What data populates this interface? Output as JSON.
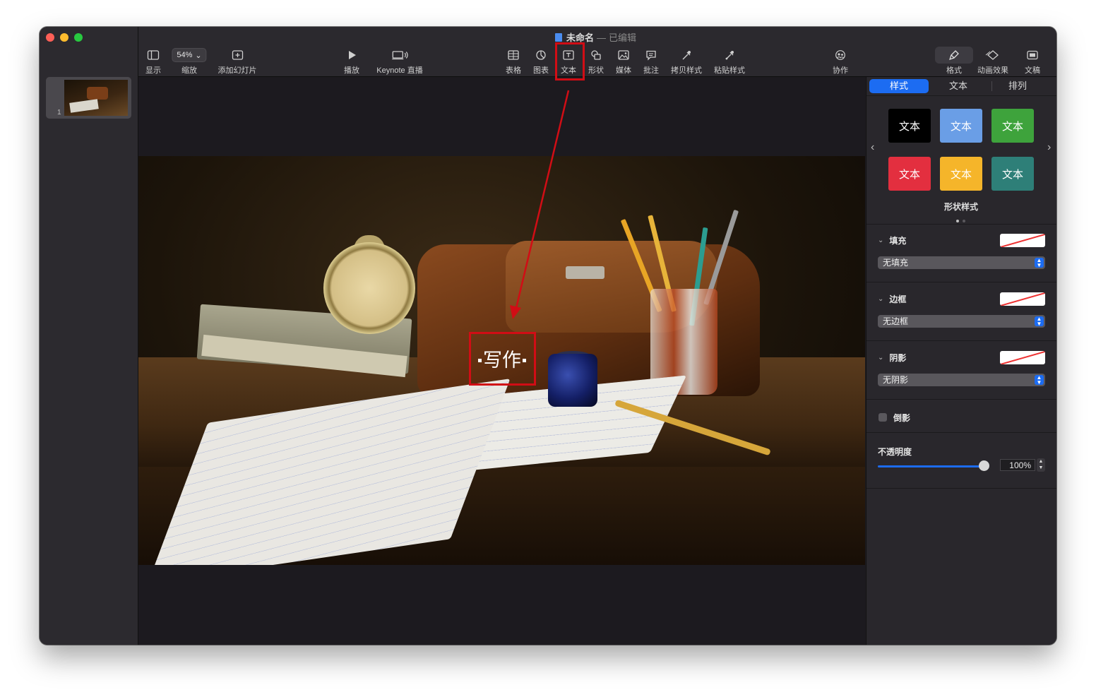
{
  "window": {
    "title": "未命名",
    "status": "已编辑"
  },
  "toolbar": {
    "view_label": "显示",
    "zoom_value": "54%",
    "zoom_label": "缩放",
    "add_slide_label": "添加幻灯片",
    "play_label": "播放",
    "live_label": "Keynote 直播",
    "table_label": "表格",
    "chart_label": "图表",
    "text_label": "文本",
    "shape_label": "形状",
    "media_label": "媒体",
    "comment_label": "批注",
    "copy_style_label": "拷贝样式",
    "paste_style_label": "粘贴样式",
    "collaborate_label": "协作",
    "format_label": "格式",
    "animate_label": "动画效果",
    "document_label": "文稿"
  },
  "navigator": {
    "slide_number": "1"
  },
  "slide": {
    "text_box": "写作"
  },
  "inspector": {
    "tabs": [
      "样式",
      "文本",
      "排列"
    ],
    "active_tab": "样式",
    "swatches": [
      "文本",
      "文本",
      "文本",
      "文本",
      "文本",
      "文本"
    ],
    "swatch_colors": [
      "#000000",
      "#6a9ee6",
      "#3ea33c",
      "#e32f3f",
      "#f5b52a",
      "#2e7f78"
    ],
    "shape_styles_label": "形状样式",
    "fill": {
      "label": "填充",
      "value": "无填充"
    },
    "border": {
      "label": "边框",
      "value": "无边框"
    },
    "shadow": {
      "label": "阴影",
      "value": "无阴影"
    },
    "reflection_label": "倒影",
    "opacity": {
      "label": "不透明度",
      "value": "100%"
    }
  },
  "colors": {
    "accent": "#1c6cf2",
    "annotation": "#d10d15"
  }
}
